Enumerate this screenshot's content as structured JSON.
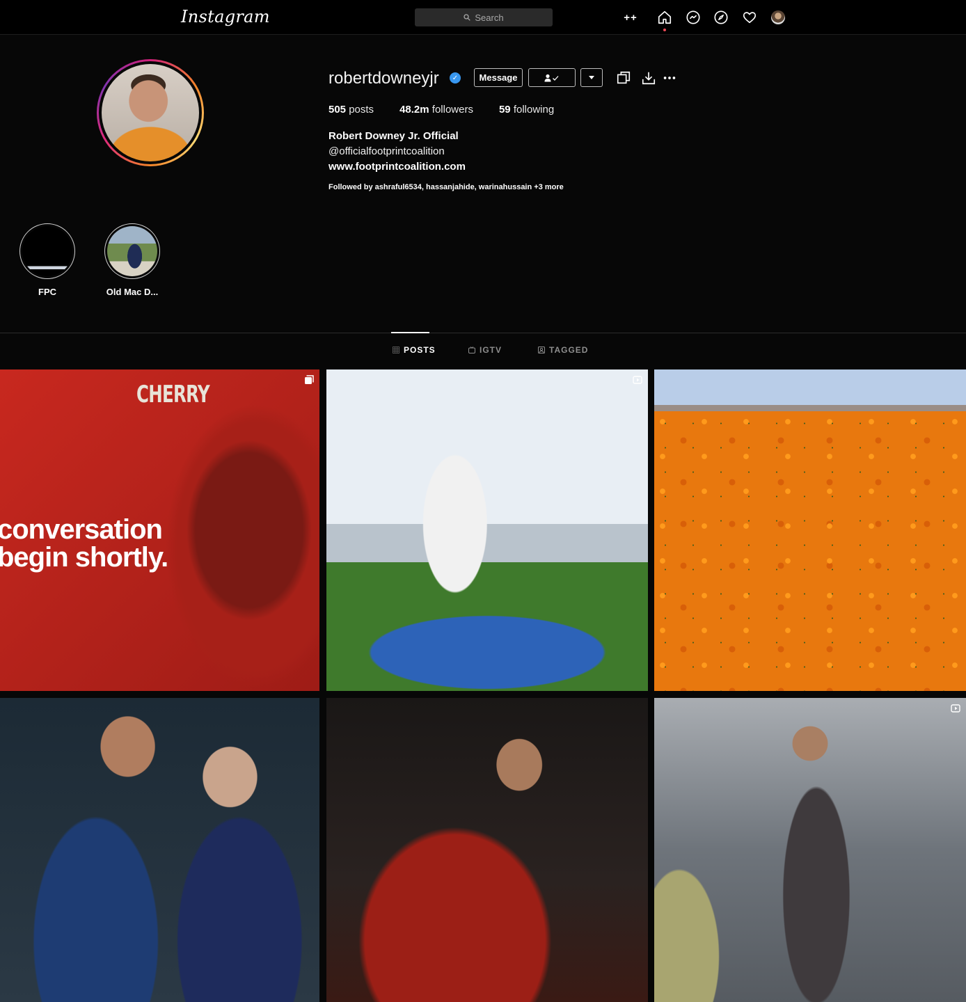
{
  "topbar": {
    "logo": "Instagram",
    "search_placeholder": "Search",
    "plusplus": "++"
  },
  "profile": {
    "username": "robertdowneyjr",
    "verified_mark": "✓",
    "message_button": "Message",
    "stats": {
      "posts_count": "505",
      "posts_label": "posts",
      "followers_count": "48.2m",
      "followers_label": "followers",
      "following_count": "59",
      "following_label": "following"
    },
    "full_name": "Robert Downey Jr. Official",
    "bio_mention": "@officialfootprintcoalition",
    "website": "www.footprintcoalition.com",
    "followed_by": "Followed by ashraful6534, hassanjahide, warinahussain +3 more"
  },
  "highlights": [
    {
      "label": "FPC"
    },
    {
      "label": "Old Mac D..."
    }
  ],
  "tabs": [
    {
      "label": "POSTS",
      "active": true
    },
    {
      "label": "IGTV",
      "active": false
    },
    {
      "label": "TAGGED",
      "active": false
    }
  ],
  "posts": {
    "post1_title": "CHERRY",
    "post1_caption_line1": "conversation",
    "post1_caption_line2": "begin shortly."
  },
  "colors": {
    "accent_blue": "#3897f0",
    "notification_red": "#ed4956",
    "background": "#070707"
  },
  "icons": [
    "search-icon",
    "home-icon",
    "messenger-icon",
    "explore-icon",
    "heart-icon",
    "follow-check-icon",
    "chevron-down-icon",
    "copy-icon",
    "download-icon",
    "more-icon",
    "grid-icon",
    "igtv-icon",
    "tagged-icon",
    "carousel-icon"
  ]
}
